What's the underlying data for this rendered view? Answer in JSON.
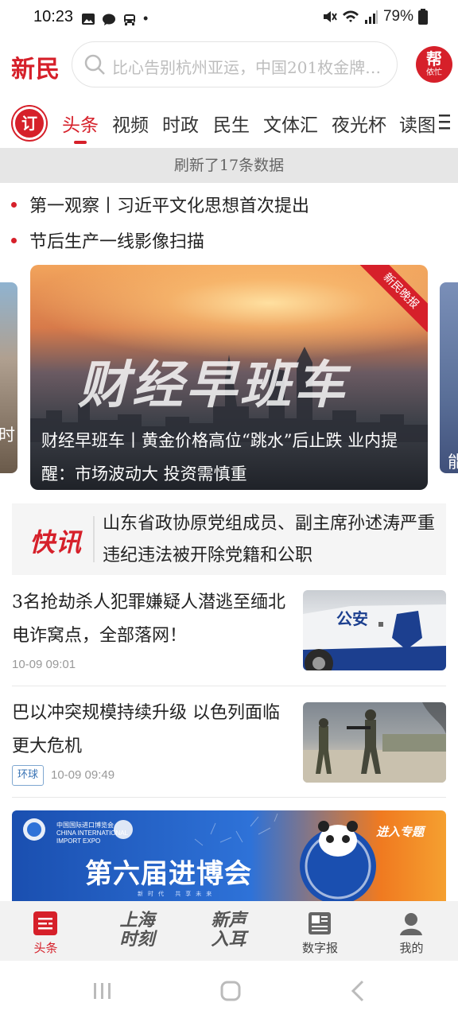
{
  "status_bar": {
    "time": "10:23",
    "battery": "79%",
    "dot": "•"
  },
  "header": {
    "logo": "新民",
    "search_placeholder": "比心告别杭州亚运，中国201枚金牌…",
    "help_badge_big": "帮",
    "help_badge_small": "侬忙"
  },
  "tabs": {
    "subscribe_label": "订",
    "items": [
      "头条",
      "视频",
      "时政",
      "民生",
      "文体汇",
      "夜光杯",
      "读图"
    ],
    "active_index": 0
  },
  "refresh_text": "刷新了17条数据",
  "headlines": [
    "第一观察丨习近平文化思想首次提出",
    "节后生产一线影像扫描"
  ],
  "carousel": {
    "image_title": "财经早班车",
    "ribbon": "新民晚报",
    "caption": "财经早班车丨黄金价格高位“跳水”后止跌 业内提醒：市场波动大 投资需慎重",
    "left_peek_text": "时",
    "right_peek_text": "能"
  },
  "flash": {
    "label": "快讯",
    "text": "山东省政协原党组成员、副主席孙述涛严重违纪违法被开除党籍和公职"
  },
  "news": [
    {
      "title": "3名抢劫杀人犯罪嫌疑人潜逃至缅北电诈窝点，全部落网！",
      "time": "10-09 09:01",
      "image_text": "公安",
      "tag": ""
    },
    {
      "title": "巴以冲突规模持续升级 以色列面临更大危机",
      "time": "10-09 09:49",
      "tag": "环球"
    }
  ],
  "banner": {
    "org": "中国国际进口博览会 CHINA INTERNATIONAL IMPORT EXPO",
    "title": "第六届进博会",
    "subtitle": "新时代 共享未来",
    "link": "进入专题"
  },
  "bottom_nav": {
    "items": [
      {
        "label": "头条",
        "active": true
      },
      {
        "label": "上海时刻",
        "brand": true
      },
      {
        "label": "新声入耳",
        "brand": true
      },
      {
        "label": "数字报"
      },
      {
        "label": "我的"
      }
    ],
    "brand1_line1": "上海",
    "brand1_line2": "时刻",
    "brand2_line1": "新声",
    "brand2_line2": "入耳"
  },
  "colors": {
    "brand_red": "#d6202a",
    "refresh_bg": "#e6e6e6",
    "tag_blue": "#3a74b5"
  }
}
